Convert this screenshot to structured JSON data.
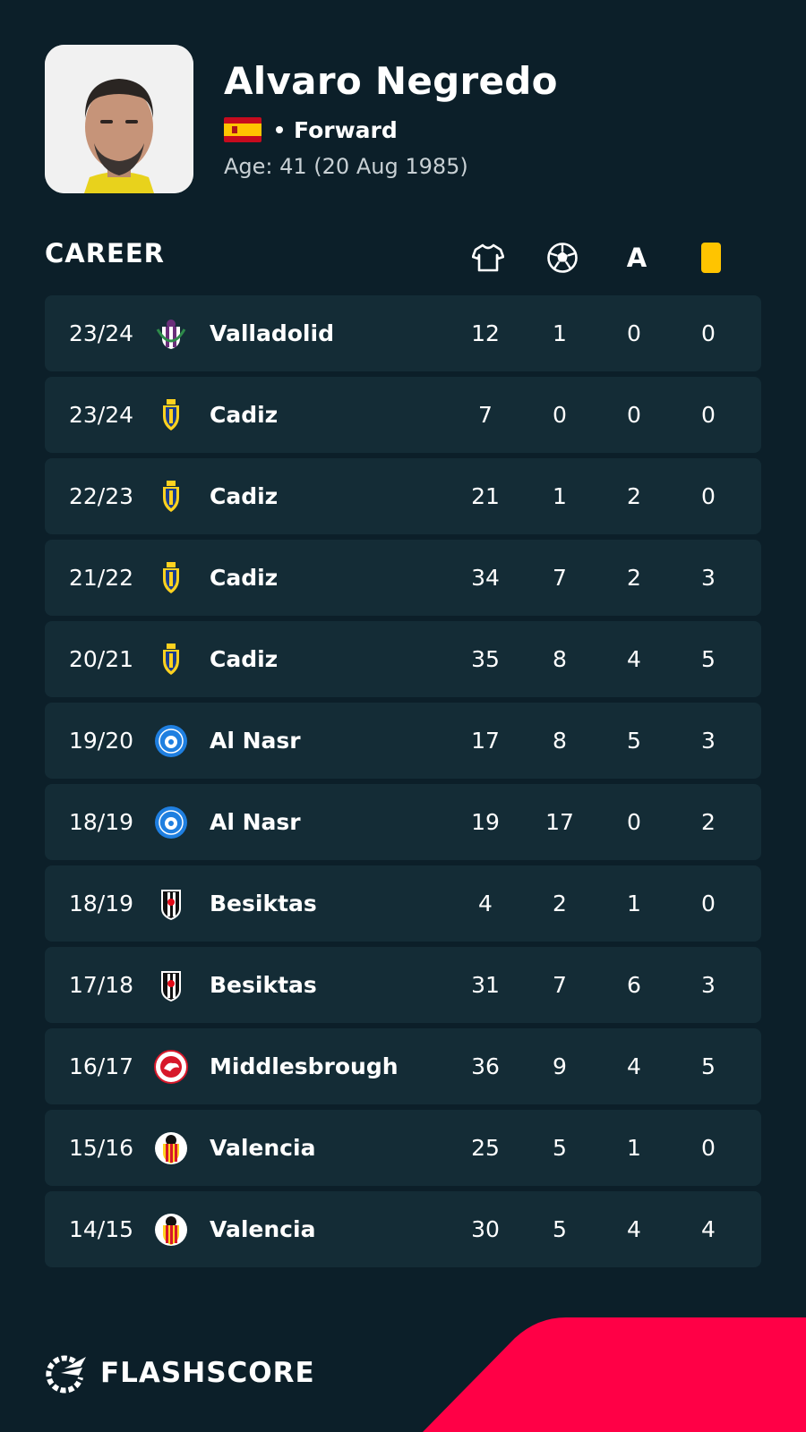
{
  "player": {
    "name": "Alvaro Negredo",
    "position": "Forward",
    "age_text": "Age: 41  (20 Aug 1985)",
    "flag_icon": "spain-flag-icon"
  },
  "career": {
    "title": "CAREER",
    "columns": [
      {
        "icon": "jersey-icon"
      },
      {
        "icon": "soccer-ball-icon"
      },
      {
        "icon": "assist-a-icon",
        "text": "A"
      },
      {
        "icon": "yellow-card-icon"
      }
    ],
    "rows": [
      {
        "season": "23/24",
        "club": "Valladolid",
        "crest": "valladolid-crest-icon",
        "apps": "12",
        "goals": "1",
        "assists": "0",
        "yellow": "0"
      },
      {
        "season": "23/24",
        "club": "Cadiz",
        "crest": "cadiz-crest-icon",
        "apps": "7",
        "goals": "0",
        "assists": "0",
        "yellow": "0"
      },
      {
        "season": "22/23",
        "club": "Cadiz",
        "crest": "cadiz-crest-icon",
        "apps": "21",
        "goals": "1",
        "assists": "2",
        "yellow": "0"
      },
      {
        "season": "21/22",
        "club": "Cadiz",
        "crest": "cadiz-crest-icon",
        "apps": "34",
        "goals": "7",
        "assists": "2",
        "yellow": "3"
      },
      {
        "season": "20/21",
        "club": "Cadiz",
        "crest": "cadiz-crest-icon",
        "apps": "35",
        "goals": "8",
        "assists": "4",
        "yellow": "5"
      },
      {
        "season": "19/20",
        "club": "Al Nasr",
        "crest": "al-nasr-crest-icon",
        "apps": "17",
        "goals": "8",
        "assists": "5",
        "yellow": "3"
      },
      {
        "season": "18/19",
        "club": "Al Nasr",
        "crest": "al-nasr-crest-icon",
        "apps": "19",
        "goals": "17",
        "assists": "0",
        "yellow": "2"
      },
      {
        "season": "18/19",
        "club": "Besiktas",
        "crest": "besiktas-crest-icon",
        "apps": "4",
        "goals": "2",
        "assists": "1",
        "yellow": "0"
      },
      {
        "season": "17/18",
        "club": "Besiktas",
        "crest": "besiktas-crest-icon",
        "apps": "31",
        "goals": "7",
        "assists": "6",
        "yellow": "3"
      },
      {
        "season": "16/17",
        "club": "Middlesbrough",
        "crest": "middlesbrough-crest-icon",
        "apps": "36",
        "goals": "9",
        "assists": "4",
        "yellow": "5"
      },
      {
        "season": "15/16",
        "club": "Valencia",
        "crest": "valencia-crest-icon",
        "apps": "25",
        "goals": "5",
        "assists": "1",
        "yellow": "0"
      },
      {
        "season": "14/15",
        "club": "Valencia",
        "crest": "valencia-crest-icon",
        "apps": "30",
        "goals": "5",
        "assists": "4",
        "yellow": "4"
      }
    ]
  },
  "brand": {
    "name": "FLASHSCORE",
    "logo_icon": "flashscore-logo-icon"
  },
  "colors": {
    "background": "#0c1f29",
    "row": "#142c36",
    "accent": "#ff0046",
    "yellow_card": "#ffc400"
  }
}
